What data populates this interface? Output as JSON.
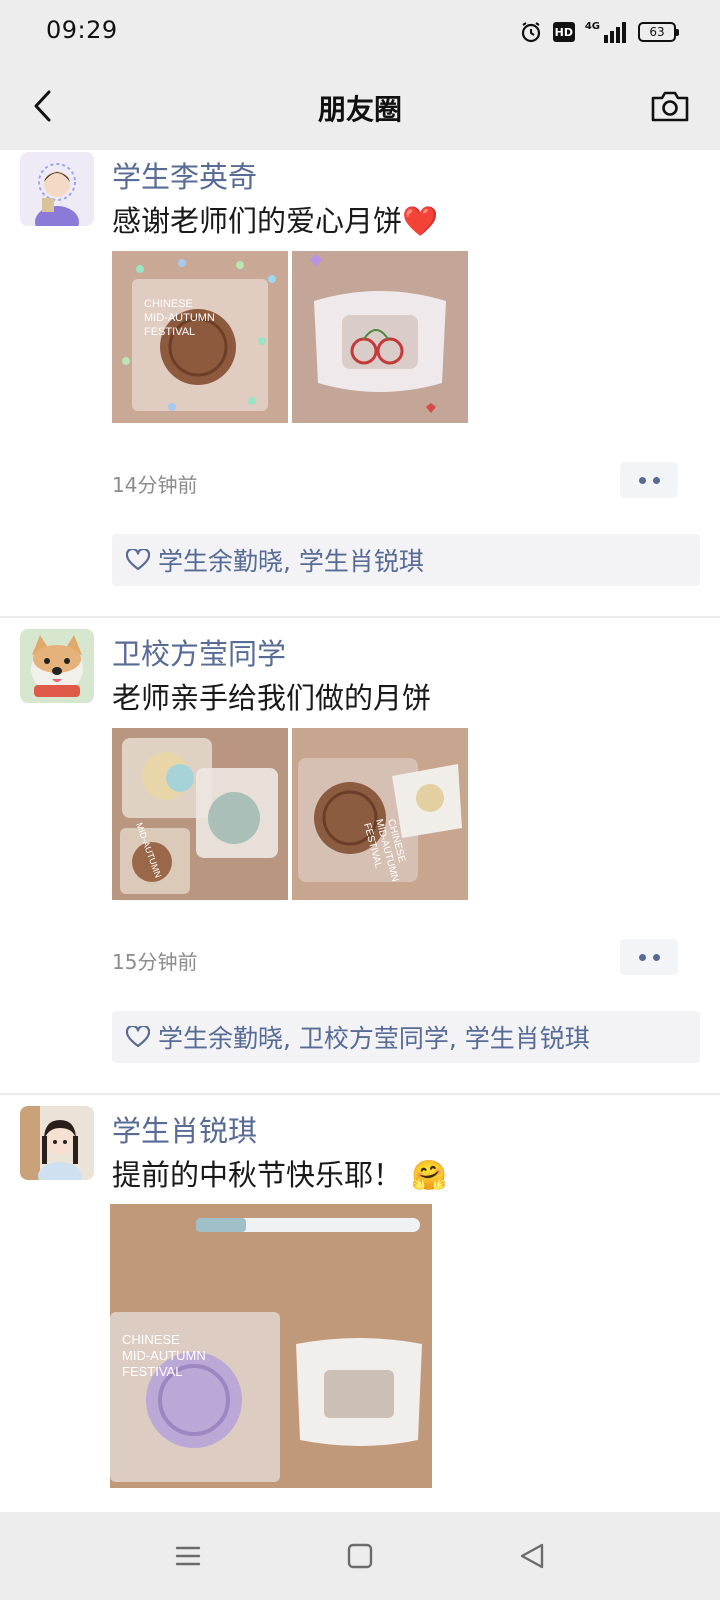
{
  "status": {
    "time": "09:29",
    "hd": "HD",
    "network": "4G",
    "battery": "63"
  },
  "nav": {
    "title": "朋友圈"
  },
  "posts": [
    {
      "author": "学生李英奇",
      "text": "感谢老师们的爱心月饼",
      "emoji": "❤️",
      "timestamp": "14分钟前",
      "likes": "学生余勤晓, 学生肖锐琪",
      "photo_text": [
        "CHINESE",
        "MID-AUTUMN",
        "FESTIVAL"
      ]
    },
    {
      "author": "卫校方莹同学",
      "text": "老师亲手给我们做的月饼",
      "timestamp": "15分钟前",
      "likes": "学生余勤晓, 卫校方莹同学, 学生肖锐琪",
      "photo_text": [
        "CHINESE",
        "MID-AUTUMN",
        "FESTIVAL"
      ]
    },
    {
      "author": "学生肖锐琪",
      "text": "提前的中秋节快乐耶！",
      "emoji": "🤗",
      "photo_text": [
        "CHINESE",
        "MID-AUTUMN",
        "FESTIVAL"
      ]
    }
  ],
  "icons": {
    "back": "chevron-left-icon",
    "camera": "camera-icon",
    "like": "heart-icon",
    "more": "more-dots-icon",
    "menu": "menu-icon",
    "home": "home-icon",
    "sys_back": "back-triangle-icon"
  },
  "colors": {
    "link": "#576b95",
    "bar": "#ededed",
    "text": "#191919",
    "meta": "#8c8c8c"
  }
}
